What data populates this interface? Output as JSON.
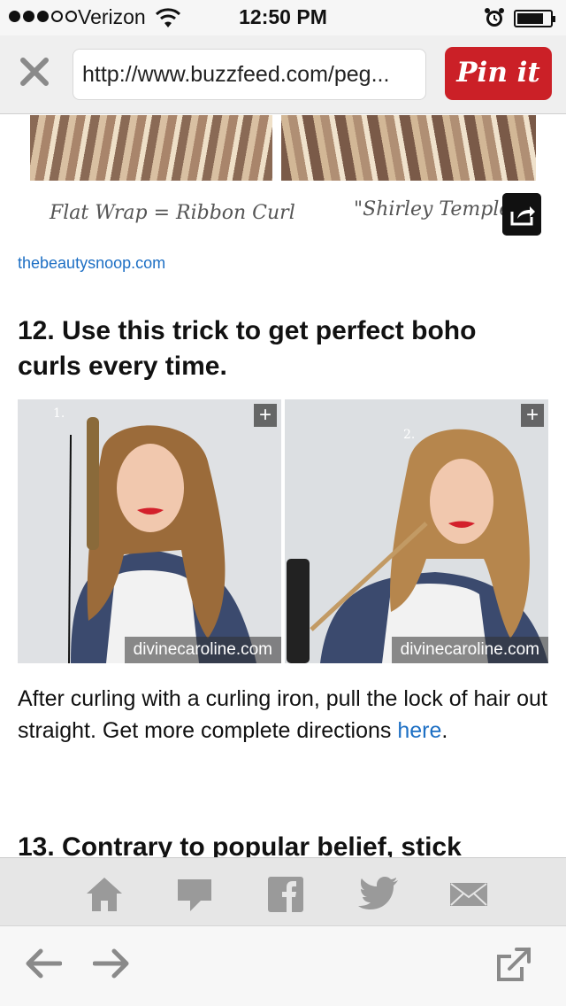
{
  "status_bar": {
    "carrier": "Verizon",
    "time": "12:50 PM",
    "signal_bars": 3,
    "signal_total": 5,
    "battery_level": 0.8
  },
  "browser": {
    "url": "http://www.buzzfeed.com/peg...",
    "pin_button_label": "Pin it",
    "pin_color": "#cb2027"
  },
  "article": {
    "top_image_captions": {
      "left": "Flat Wrap = Ribbon Curl",
      "right": "\"Shirley Temple"
    },
    "top_image_source": "thebeautysnoop.com",
    "item_12": {
      "heading": "12. Use this trick to get perfect boho curls every time.",
      "photos": [
        {
          "step": "1.",
          "credit": "divinecaroline.com"
        },
        {
          "step": "2.",
          "credit": "divinecaroline.com"
        }
      ],
      "body_before_link": "After curling with a curling iron, pull the lock of hair out straight. Get more complete directions ",
      "link_text": "here",
      "body_after_link": "."
    },
    "item_13": {
      "heading": "13. Contrary to popular belief, stick"
    },
    "link_color": "#1d6fc4"
  },
  "share_bar": {
    "icons": [
      "home-icon",
      "comment-icon",
      "facebook-icon",
      "twitter-icon",
      "mail-icon"
    ]
  },
  "bottom_bar": {
    "icons": [
      "back-arrow-icon",
      "forward-arrow-icon",
      "open-external-icon"
    ]
  }
}
